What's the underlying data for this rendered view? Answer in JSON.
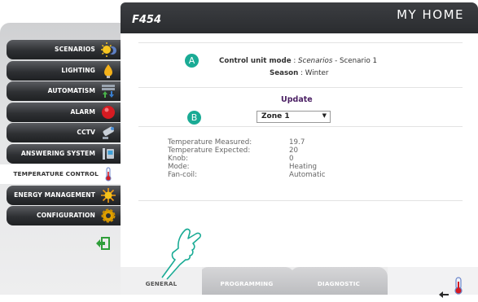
{
  "header": {
    "model": "F454",
    "brand": "MY HOME"
  },
  "menu": {
    "items": [
      {
        "label": "SCENARIOS",
        "icon": "scenarios-sun-icon"
      },
      {
        "label": "LIGHTING",
        "icon": "lightbulb-icon"
      },
      {
        "label": "AUTOMATISM",
        "icon": "automatism-arrows-icon"
      },
      {
        "label": "ALARM",
        "icon": "alarm-icon"
      },
      {
        "label": "CCTV",
        "icon": "camera-icon"
      },
      {
        "label": "ANSWERING SYSTEM",
        "icon": "answering-icon"
      },
      {
        "label": "TEMPERATURE CONTROL",
        "icon": "thermometer-icon"
      },
      {
        "label": "ENERGY MANAGEMENT",
        "icon": "energy-icon"
      },
      {
        "label": "CONFIGURATION",
        "icon": "gear-icon"
      }
    ],
    "active_index": 6
  },
  "markers": {
    "a": "A",
    "b": "B"
  },
  "status": {
    "mode_label": "Control unit mode",
    "mode_value_italic": "Scenarios",
    "mode_value_rest": " - Scenario 1",
    "season_label": "Season",
    "season_value": "Winter"
  },
  "update_label": "Update",
  "zone_select": {
    "selected": "Zone 1"
  },
  "readings": [
    {
      "label": "Temperature Measured:",
      "value": "19.7"
    },
    {
      "label": "Temperature Expected:",
      "value": "20"
    },
    {
      "label": "Knob:",
      "value": "0"
    },
    {
      "label": "Mode:",
      "value": "Heating"
    },
    {
      "label": "Fan-coil:",
      "value": "Automatic"
    }
  ],
  "tabs": [
    "GENERAL",
    "PROGRAMMING",
    "DIAGNOSTIC"
  ],
  "colors": {
    "accent": "#1aab95",
    "update_title": "#4a1f63",
    "menu_dark": "#2e3033"
  }
}
